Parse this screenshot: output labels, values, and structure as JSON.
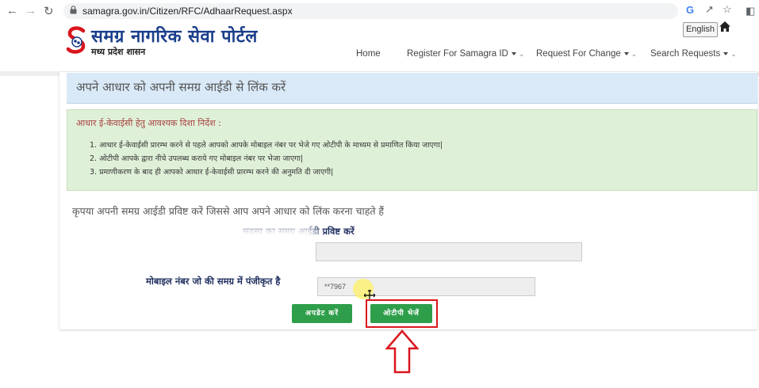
{
  "browser": {
    "url": "samagra.gov.in/Citizen/RFC/AdhaarRequest.aspx"
  },
  "header": {
    "logo_title": "समग्र नागरिक सेवा पोर्टल",
    "logo_subtitle": "मध्य प्रदेश शासन",
    "language_button": "English",
    "menu": {
      "home": "Home",
      "register": "Register For Samagra ID",
      "request_change": "Request For Change",
      "search_requests": "Search Requests"
    }
  },
  "panel": {
    "title": "अपने आधार को अपनी समग्र आईडी से लिंक करें",
    "instructions_heading": "आधार ई-केवाईसी हेतु आवश्यक दिशा निर्देश :",
    "instructions": [
      "1. आधार ई-केवाईसी प्रारम्भ करने से पहले आपको आपके मोबाइल नंबर पर भेजे गए ओटीपी के माध्यम से प्रमाणित किया जाएगा|",
      "2. ओटीपी आपके द्वारा नीचे उपलब्ध कराये गए मोबाइल नंबर पर भेजा जाएगा|",
      "3. प्रमाणीकरण के बाद ही आपको आधार ई-केवाईसी प्रारम्भ करने की अनुमति दी जाएगी|"
    ],
    "prompt": "कृपया अपनी समग्र आईडी प्रविष्ट करें जिससे आप अपने आधार को लिंक करना चाहते हैं",
    "samagra_label": "सदस्य का समग्र आईडी प्रविष्ट करें",
    "samagra_value": "",
    "mobile_label": "मोबाइल नंबर जो की समग्र में पंजीकृत है",
    "mobile_value": "**7967",
    "update_button": "अपडेट करें",
    "send_otp_button": "ओटीपी भेजें"
  },
  "colors": {
    "button_green": "#2e9e4b",
    "highlight_red": "#d9161d",
    "title_bar_blue": "#d9e9f7",
    "info_green": "#dff0d8"
  }
}
